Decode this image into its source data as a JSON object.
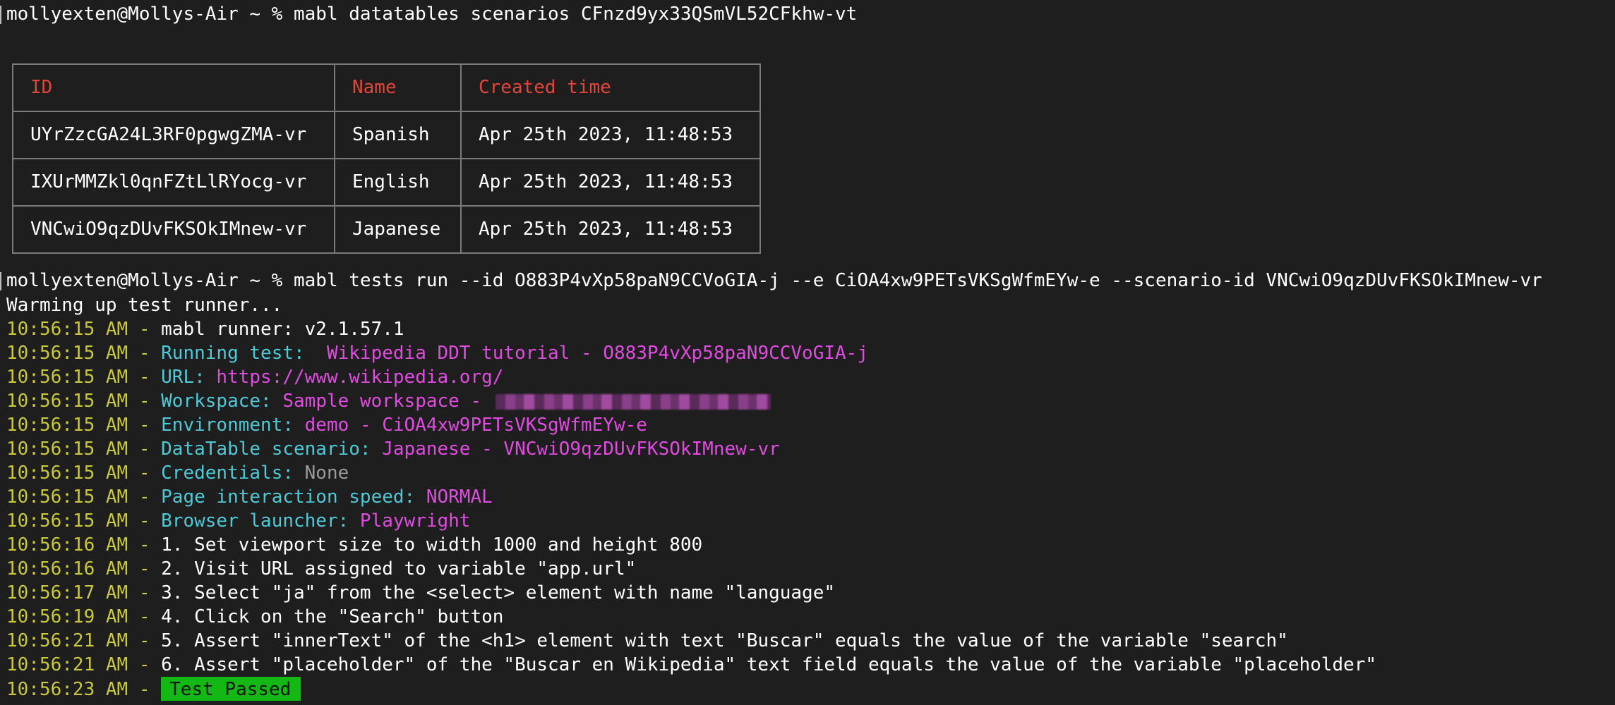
{
  "terminal": {
    "prompt": "mollyexten@Mollys-Air ~ %",
    "command1": "mabl datatables scenarios CFnzd9yx33QSmVL52CFkhw-vt",
    "command2": "mabl tests run --id O883P4vXp58paN9CCVoGIA-j --e CiOA4xw9PETsVKSgWfmEYw-e --scenario-id VNCwiO9qzDUvFKSOkIMnew-vr"
  },
  "table": {
    "headers": [
      "ID",
      "Name",
      "Created time"
    ],
    "rows": [
      [
        "UYrZzcGA24L3RF0pgwgZMA-vr",
        "Spanish",
        "Apr 25th 2023, 11:48:53"
      ],
      [
        "IXUrMMZkl0qnFZtLlRYocg-vr",
        "English",
        "Apr 25th 2023, 11:48:53"
      ],
      [
        "VNCwiO9qzDUvFKSOkIMnew-vr",
        "Japanese",
        "Apr 25th 2023, 11:48:53"
      ]
    ]
  },
  "output": {
    "warming": "Warming up test runner...",
    "sep": " - ",
    "lines": [
      {
        "time": "10:56:15 AM",
        "label": "",
        "value": "mabl runner: v2.1.57.1"
      },
      {
        "time": "10:56:15 AM",
        "label": "Running test:",
        "value": "  Wikipedia DDT tutorial - O883P4vXp58paN9CCVoGIA-j"
      },
      {
        "time": "10:56:15 AM",
        "label": "URL:",
        "value": " https://www.wikipedia.org/"
      },
      {
        "time": "10:56:15 AM",
        "label": "Workspace:",
        "value": " Sample workspace - "
      },
      {
        "time": "10:56:15 AM",
        "label": "Environment:",
        "value": " demo - CiOA4xw9PETsVKSgWfmEYw-e"
      },
      {
        "time": "10:56:15 AM",
        "label": "DataTable scenario:",
        "value": " Japanese - VNCwiO9qzDUvFKSOkIMnew-vr"
      },
      {
        "time": "10:56:15 AM",
        "label": "Credentials:",
        "value": " None"
      },
      {
        "time": "10:56:15 AM",
        "label": "Page interaction speed:",
        "value": " NORMAL"
      },
      {
        "time": "10:56:15 AM",
        "label": "Browser launcher:",
        "value": " Playwright"
      },
      {
        "time": "10:56:16 AM",
        "label": "",
        "value": "1. Set viewport size to width 1000 and height 800"
      },
      {
        "time": "10:56:16 AM",
        "label": "",
        "value": "2. Visit URL assigned to variable \"app.url\""
      },
      {
        "time": "10:56:17 AM",
        "label": "",
        "value": "3. Select \"ja\" from the <select> element with name \"language\""
      },
      {
        "time": "10:56:19 AM",
        "label": "",
        "value": "4. Click on the \"Search\" button"
      },
      {
        "time": "10:56:21 AM",
        "label": "",
        "value": "5. Assert \"innerText\" of the <h1> element with text \"Buscar\" equals the value of the variable \"search\""
      },
      {
        "time": "10:56:21 AM",
        "label": "",
        "value": "6. Assert \"placeholder\" of the \"Buscar en Wikipedia\" text field equals the value of the variable \"placeholder\""
      },
      {
        "time": "10:56:23 AM",
        "label": "",
        "value": "Test Passed"
      }
    ]
  },
  "colors": {
    "background": "#1e1e1e",
    "timestamp": "#c8c83a",
    "label": "#4ec9d6",
    "value": "#e04be0",
    "header": "#e0473a",
    "passed": "#14b814"
  }
}
